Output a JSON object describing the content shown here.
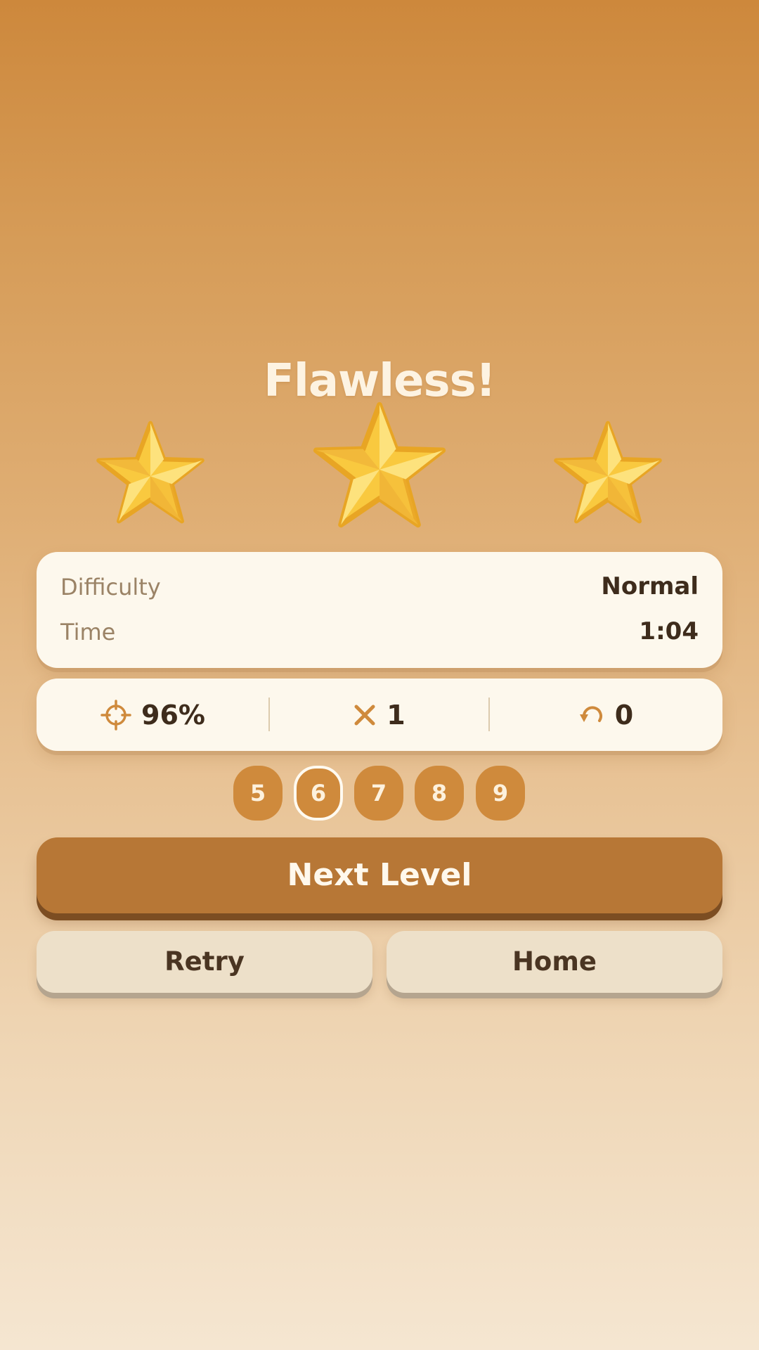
{
  "result": {
    "title": "Flawless!",
    "stars_earned": 3,
    "stars_total": 3
  },
  "info": {
    "difficulty_label": "Difficulty",
    "difficulty_value": "Normal",
    "time_label": "Time",
    "time_value": "1:04"
  },
  "stats": {
    "accuracy": "96%",
    "accuracy_icon": "crosshair-icon",
    "mistakes": "1",
    "mistakes_icon": "x-mark-icon",
    "undos": "0",
    "undos_icon": "undo-arrow-icon"
  },
  "levels": {
    "items": [
      "5",
      "6",
      "7",
      "8",
      "9"
    ],
    "current": "6"
  },
  "buttons": {
    "next_label": "Next Level",
    "retry_label": "Retry",
    "home_label": "Home"
  },
  "colors": {
    "star_fill": "#f9c93f",
    "star_outline": "#e8a524",
    "accent": "#cf8a3c",
    "primary_button": "#b77736",
    "secondary_button": "#ede0c9",
    "card": "#fdf8ed",
    "title_text": "#fdf3e2"
  }
}
